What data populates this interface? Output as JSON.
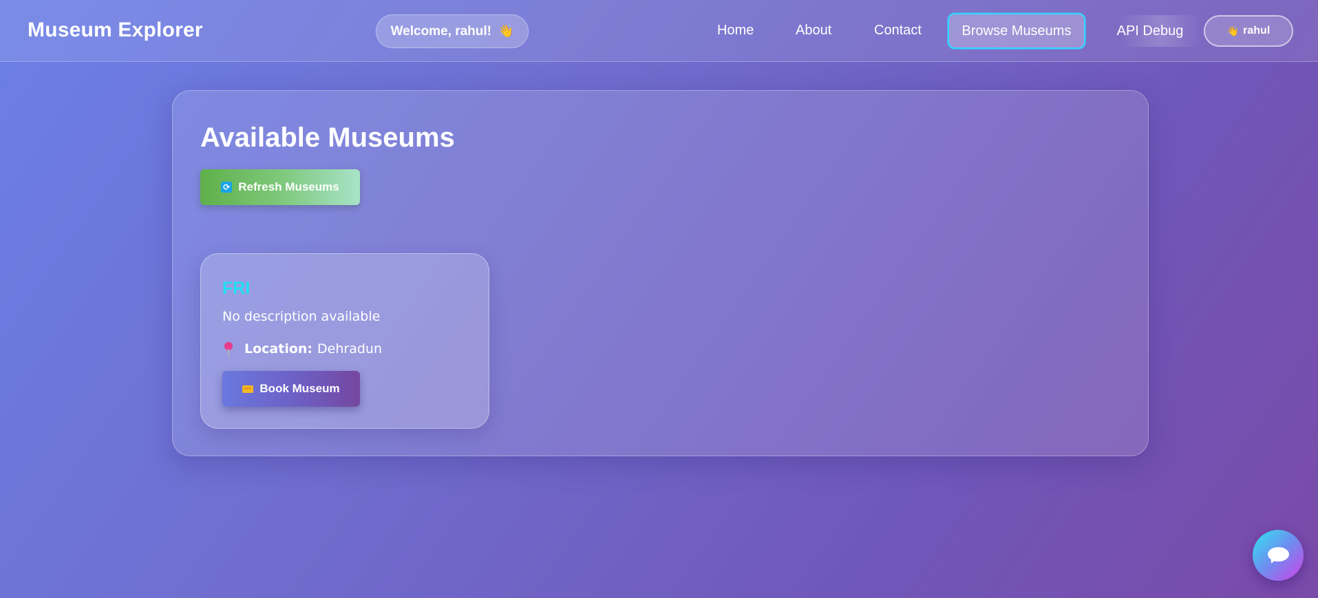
{
  "header": {
    "brand": "Museum Explorer",
    "welcome_text": "Welcome, rahul!",
    "welcome_emoji": "👋",
    "nav": [
      {
        "label": "Home"
      },
      {
        "label": "About"
      },
      {
        "label": "Contact"
      },
      {
        "label": "Browse Museums",
        "active": true
      },
      {
        "label": "API Debug"
      }
    ],
    "user_button": {
      "emoji": "👋",
      "label": "rahul"
    }
  },
  "main": {
    "title": "Available Museums",
    "refresh_label": "Refresh Museums",
    "museums": [
      {
        "name": "FRI",
        "description": "No description available",
        "location_label": "Location:",
        "location": "Dehradun",
        "book_label": "Book Museum"
      }
    ]
  },
  "icons": {
    "refresh": "refresh-icon",
    "pin": "pin-icon",
    "ticket": "ticket-icon",
    "chat": "chat-icon"
  },
  "colors": {
    "accent_cyan": "#1fe0f5",
    "active_border": "#33d6ff",
    "refresh_green": "#5fb04a"
  }
}
